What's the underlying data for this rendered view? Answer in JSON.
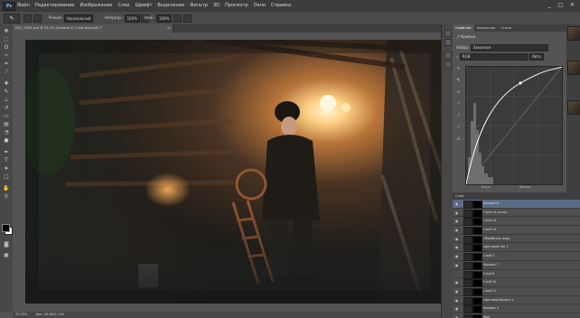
{
  "app": {
    "logo": "Ps"
  },
  "menu": {
    "items": [
      "Файл",
      "Редактирование",
      "Изображение",
      "Слои",
      "Шрифт",
      "Выделение",
      "Фильтр",
      "3D",
      "Просмотр",
      "Окно",
      "Справка"
    ],
    "window_controls": "_ □ ✕"
  },
  "options_bar": {
    "mode_label": "Режим:",
    "mode_value": "Нормальный",
    "opacity_label": "Непрозр.:",
    "opacity_value": "100%",
    "flow_label": "Наж.:",
    "flow_value": "100%"
  },
  "document": {
    "tab_title": "DSC_7834.psd @ 33,3% (Кривые 8, Слой-маска/8) *",
    "tab_close": "×"
  },
  "status": {
    "zoom": "33,33%",
    "doc_size": "Док: 36,0M/1,03G"
  },
  "properties": {
    "tabs": [
      "Свойства",
      "Коррекция",
      "Стили"
    ],
    "active_tab": "Свойства",
    "panel_title": "Кривые",
    "preset_label": "Набор:",
    "preset_value": "Заказная",
    "channel_value": "RGB",
    "auto_button": "Авто",
    "input_label": "Вход:",
    "output_label": "Выход:"
  },
  "layers_panel": {
    "title": "Слои",
    "layers": [
      {
        "name": "Кривые 8",
        "visible": true,
        "selected": true
      },
      {
        "name": "Слой 14 копия",
        "visible": true,
        "selected": false
      },
      {
        "name": "Слой 14",
        "visible": true,
        "selected": false
      },
      {
        "name": "Слой 13",
        "visible": true,
        "selected": false
      },
      {
        "name": "Обработка лица",
        "visible": true,
        "selected": false
      },
      {
        "name": "Цветовой тон 1",
        "visible": true,
        "selected": false
      },
      {
        "name": "Слой 3",
        "visible": true,
        "selected": false
      },
      {
        "name": "Кривые 7",
        "visible": true,
        "selected": false
      },
      {
        "name": "Слой 8",
        "visible": false,
        "selected": false
      },
      {
        "name": "Слой 10",
        "visible": true,
        "selected": false
      },
      {
        "name": "Слой 11",
        "visible": true,
        "selected": false
      },
      {
        "name": "Цветовой баланс 1",
        "visible": true,
        "selected": false
      },
      {
        "name": "Кривые 3",
        "visible": true,
        "selected": false
      },
      {
        "name": "Фон",
        "visible": true,
        "selected": false
      }
    ]
  },
  "colors": {
    "menubar": "#3c3c3c",
    "panel": "#535353",
    "selected_layer": "#5a6b85",
    "lamp_glow": "#ffcf7a"
  },
  "icons": {
    "eye": "eye-icon",
    "move": "move-tool-icon"
  }
}
